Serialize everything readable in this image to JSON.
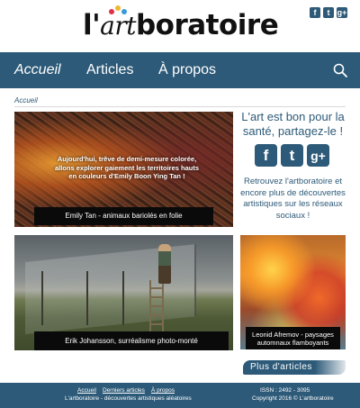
{
  "header": {
    "logo_prefix": "l'",
    "logo_art": "art",
    "logo_suffix": "boratoire",
    "social_icons": [
      "facebook-icon",
      "twitter-icon",
      "google-plus-icon"
    ]
  },
  "nav": {
    "items": [
      {
        "label": "Accueil"
      },
      {
        "label": "Articles"
      },
      {
        "label": "À propos"
      }
    ],
    "search_icon": "search-icon"
  },
  "breadcrumb": "Accueil",
  "articles": [
    {
      "overlay": "Aujourd'hui, trêve de demi-mesure colorée, allons explorer gaiement les territoires hauts en couleurs d'Emily Boon Ying Tan !",
      "caption": "Emily Tan - animaux bariolés en folie"
    },
    {
      "caption": "Erik Johansson, surréalisme photo-monté"
    },
    {
      "caption": "Leonid Afremov - paysages automnaux flamboyants"
    }
  ],
  "sidebar": {
    "title": "L'art est bon pour la santé, partagez-le !",
    "social": {
      "facebook": "f",
      "twitter": "t",
      "google": "g+"
    },
    "text": "Retrouvez l'artboratoire et encore plus de découvertes artistiques sur les réseaux sociaux !"
  },
  "more_button": "Plus d'articles",
  "footer": {
    "links": [
      "Accueil",
      "Derniers articles",
      "À propos"
    ],
    "tagline": "L'artboratoire - découvertes artistiques aléatoires",
    "issn": "ISSN : 2492 - 3095",
    "copyright": "Copyright 2016 © L'artboratoire"
  },
  "colors": {
    "primary": "#2d5a78",
    "caption_bg": "#0a0a0a"
  }
}
